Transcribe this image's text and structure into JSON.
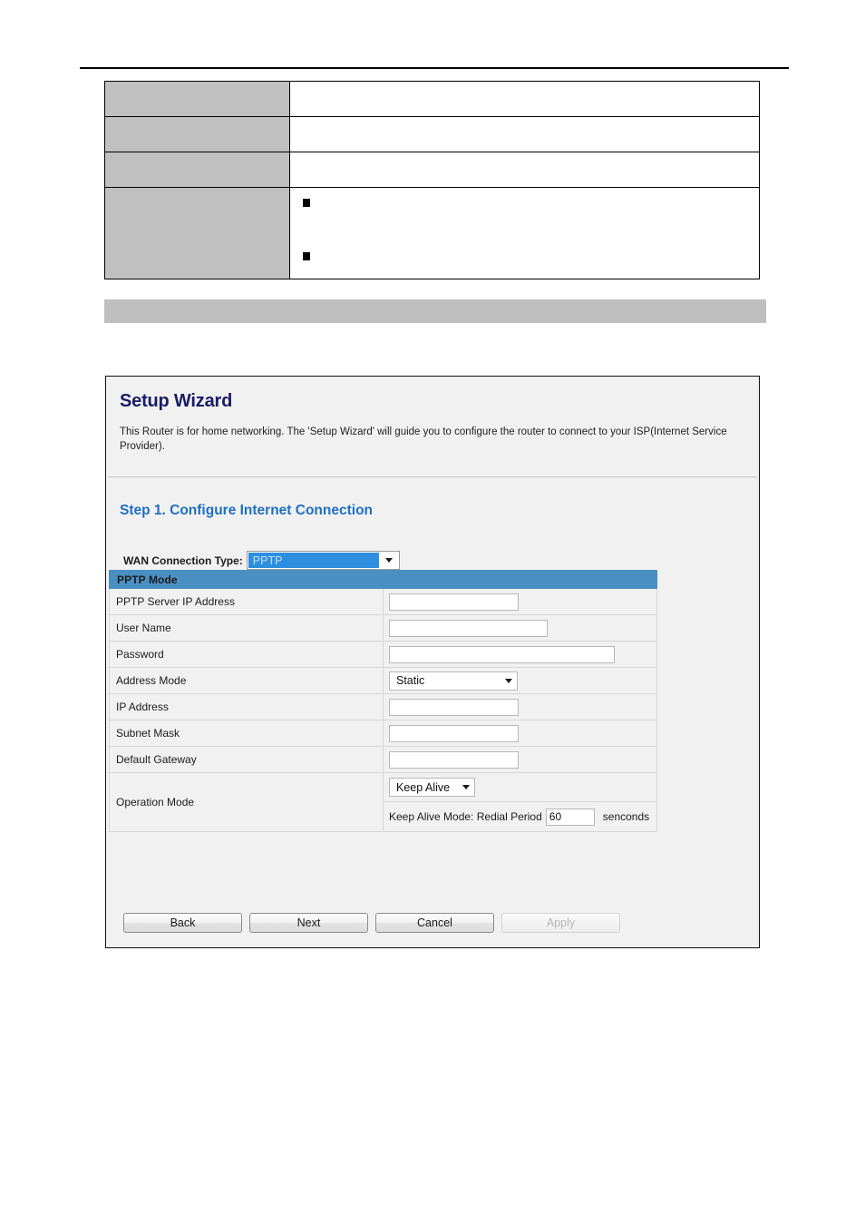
{
  "spec_table": {
    "rows": [
      {
        "label": "",
        "value": ""
      },
      {
        "label": "",
        "value": ""
      },
      {
        "label": "",
        "value": ""
      }
    ],
    "bullet_row": {
      "label": "",
      "bullet_1": "",
      "bullet_2": ""
    }
  },
  "gray_band": {
    "text": ""
  },
  "wizard": {
    "title": "Setup Wizard",
    "description": "This Router is for home networking. The 'Setup Wizard' will guide you to configure the router to connect to your ISP(Internet Service Provider).",
    "step_title": "Step 1. Configure Internet Connection",
    "wan": {
      "label": "WAN Connection Type:",
      "selected": "PPTP"
    },
    "form": {
      "header": "PPTP Mode",
      "rows": [
        {
          "label": "PPTP Server IP Address",
          "value": ""
        },
        {
          "label": "User Name",
          "value": ""
        },
        {
          "label": "Password",
          "value": ""
        },
        {
          "label": "Address Mode",
          "value": "Static"
        },
        {
          "label": "IP Address",
          "value": ""
        },
        {
          "label": "Subnet Mask",
          "value": ""
        },
        {
          "label": "Default Gateway",
          "value": ""
        },
        {
          "label": "Operation Mode",
          "value": "Keep Alive"
        }
      ],
      "keep_alive": {
        "prefix": "Keep Alive Mode: Redial Period",
        "redial_period": "60",
        "unit": "senconds"
      }
    },
    "buttons": {
      "back": "Back",
      "next": "Next",
      "cancel": "Cancel",
      "apply": "Apply"
    }
  },
  "colors": {
    "title_navy": "#1b1b66",
    "step_blue": "#1f6fc4",
    "form_header_blue": "#4a8fc2",
    "select_highlight": "#2e8fe0",
    "band_gray": "#bfbfbf",
    "cell_gray": "#c0c0c0",
    "panel_bg": "#f1f1f1"
  }
}
